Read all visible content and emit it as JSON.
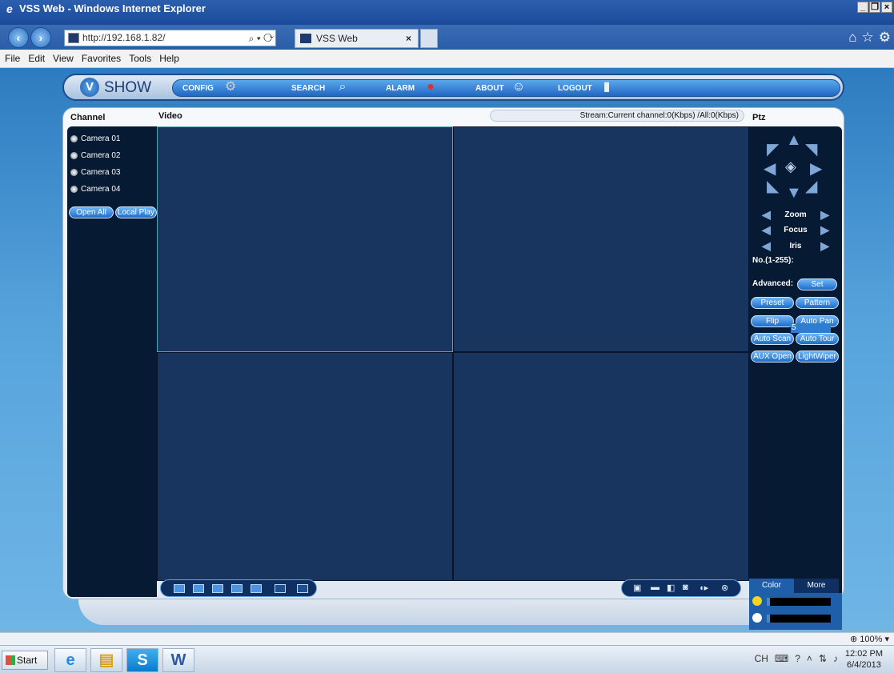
{
  "browser": {
    "title": "VSS Web - Windows Internet Explorer",
    "address": "http://192.168.1.82/",
    "tab_title": "VSS Web",
    "menu": [
      "File",
      "Edit",
      "View",
      "Favorites",
      "Tools",
      "Help"
    ],
    "zoom": "100%"
  },
  "app": {
    "logo": "SHOW",
    "nav": [
      {
        "label": "CONFIG",
        "icon": "gear-icon"
      },
      {
        "label": "SEARCH",
        "icon": "magnifier-icon"
      },
      {
        "label": "ALARM",
        "icon": "siren-icon"
      },
      {
        "label": "ABOUT",
        "icon": "smiley-icon"
      },
      {
        "label": "LOGOUT",
        "icon": "door-icon"
      }
    ]
  },
  "channel": {
    "heading": "Channel",
    "cameras": [
      "Camera 01",
      "Camera 02",
      "Camera 03",
      "Camera 04"
    ],
    "open_all": "Open All",
    "local_play": "Local Play"
  },
  "video": {
    "heading": "Video",
    "stream": "Stream:Current channel:0(Kbps) /All:0(Kbps)"
  },
  "ptz": {
    "heading": "Ptz",
    "zoom": "Zoom",
    "focus": "Focus",
    "iris": "Iris",
    "number_label": "No.(1-255):",
    "number_value": "5",
    "advanced_label": "Advanced:",
    "set": "Set",
    "buttons": [
      "Preset",
      "Pattern",
      "Flip",
      "Auto Pan",
      "Auto Scan",
      "Auto Tour",
      "AUX Open",
      "LightWiper"
    ]
  },
  "image_tabs": {
    "color": "Color",
    "more": "More"
  },
  "taskbar": {
    "start": "Start",
    "lang": "CH",
    "time": "12:02 PM",
    "date": "6/4/2013"
  }
}
